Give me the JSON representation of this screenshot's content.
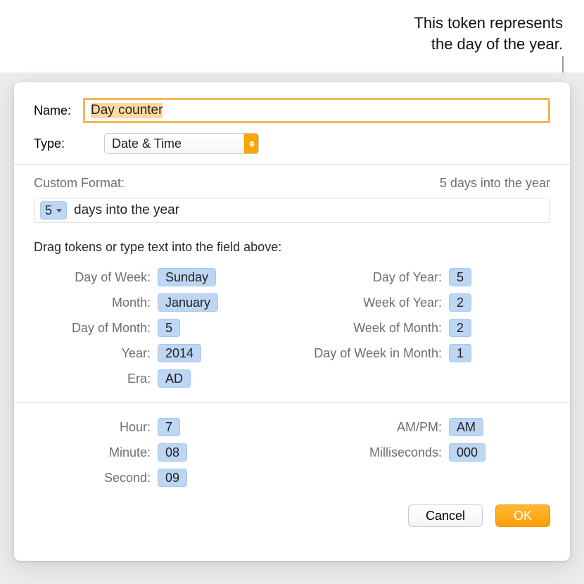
{
  "callout": {
    "line1": "This token represents",
    "line2": "the day of the year."
  },
  "name": {
    "label": "Name:",
    "value": "Day counter"
  },
  "type": {
    "label": "Type:",
    "value": "Date & Time"
  },
  "custom_format": {
    "label": "Custom Format:",
    "preview": "5 days into the year",
    "token_value": "5",
    "trailing_text": "days into the year"
  },
  "instructions": "Drag tokens or type text into the field above:",
  "tokens": {
    "left": [
      {
        "label": "Day of Week:",
        "value": "Sunday"
      },
      {
        "label": "Month:",
        "value": "January"
      },
      {
        "label": "Day of Month:",
        "value": "5"
      },
      {
        "label": "Year:",
        "value": "2014"
      },
      {
        "label": "Era:",
        "value": "AD"
      }
    ],
    "right": [
      {
        "label": "Day of Year:",
        "value": "5"
      },
      {
        "label": "Week of Year:",
        "value": "2"
      },
      {
        "label": "Week of Month:",
        "value": "2"
      },
      {
        "label": "Day of Week in Month:",
        "value": "1"
      }
    ],
    "time_left": [
      {
        "label": "Hour:",
        "value": "7"
      },
      {
        "label": "Minute:",
        "value": "08"
      },
      {
        "label": "Second:",
        "value": "09"
      }
    ],
    "time_right": [
      {
        "label": "AM/PM:",
        "value": "AM"
      },
      {
        "label": "Milliseconds:",
        "value": "000"
      }
    ]
  },
  "buttons": {
    "cancel": "Cancel",
    "ok": "OK"
  }
}
